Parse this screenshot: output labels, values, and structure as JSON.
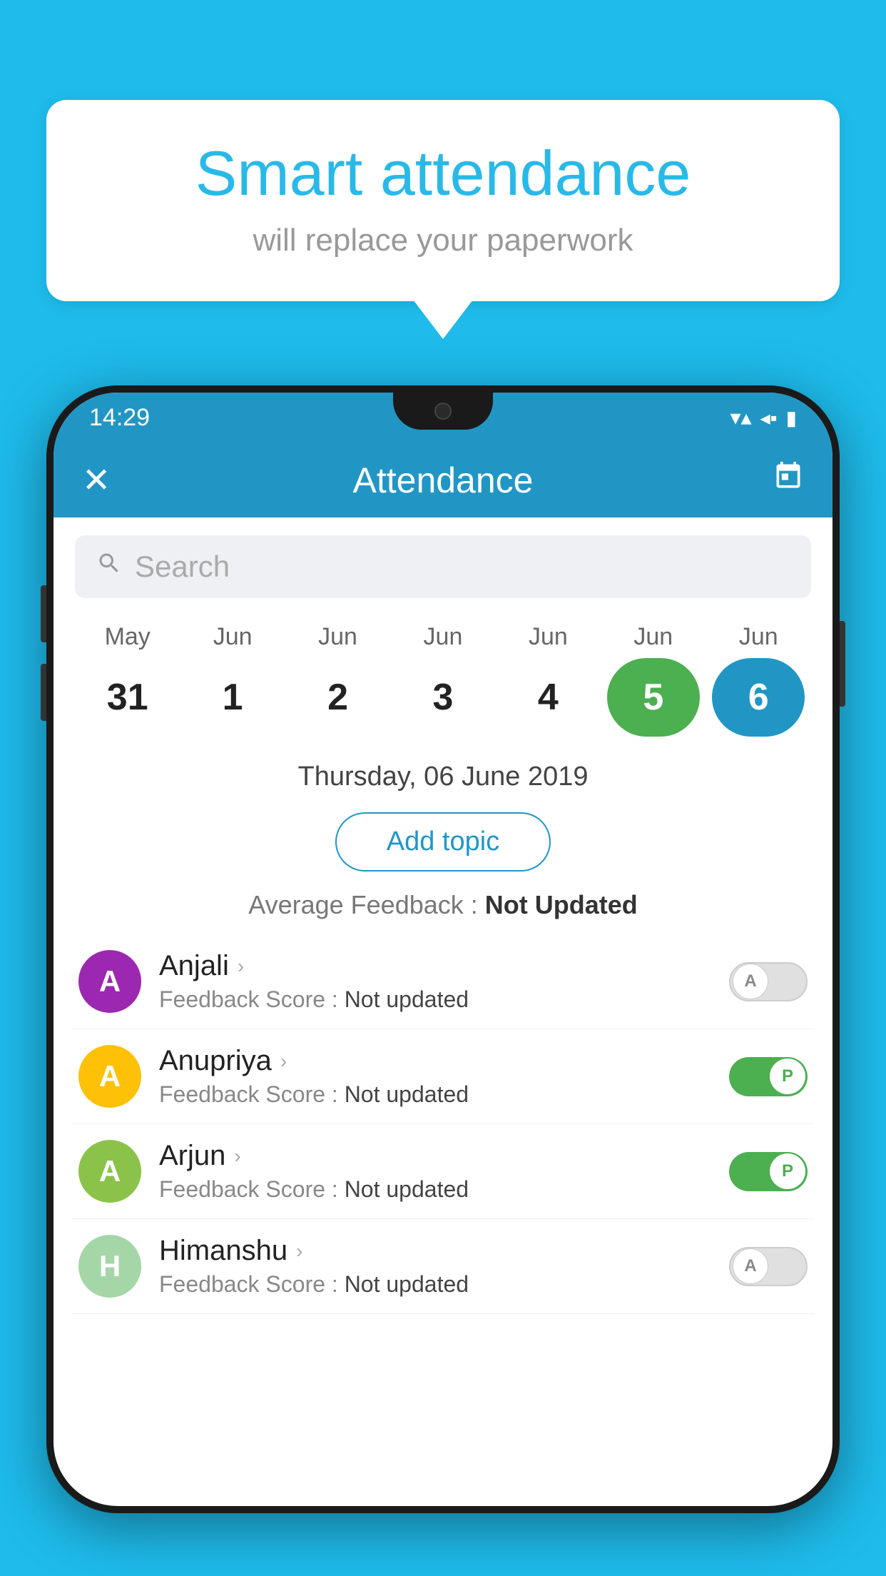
{
  "background_color": "#1EBBEB",
  "speech_bubble": {
    "title": "Smart attendance",
    "subtitle": "will replace your paperwork"
  },
  "status_bar": {
    "time": "14:29",
    "wifi_icon": "▾",
    "signal_icon": "◂",
    "battery_icon": "▮"
  },
  "app_bar": {
    "title": "Attendance",
    "close_label": "✕",
    "calendar_icon": "📅"
  },
  "search": {
    "placeholder": "Search"
  },
  "calendar": {
    "months": [
      "May",
      "Jun",
      "Jun",
      "Jun",
      "Jun",
      "Jun",
      "Jun"
    ],
    "dates": [
      "31",
      "1",
      "2",
      "3",
      "4",
      "5",
      "6"
    ],
    "today_index": 5,
    "selected_index": 6
  },
  "selected_date": "Thursday, 06 June 2019",
  "add_topic_label": "Add topic",
  "average_feedback": {
    "label": "Average Feedback : ",
    "value": "Not Updated"
  },
  "students": [
    {
      "name": "Anjali",
      "avatar_letter": "A",
      "avatar_color": "#9C27B0",
      "feedback_label": "Feedback Score : ",
      "feedback_value": "Not updated",
      "attendance": "A",
      "toggle_on": false
    },
    {
      "name": "Anupriya",
      "avatar_letter": "A",
      "avatar_color": "#FFC107",
      "feedback_label": "Feedback Score : ",
      "feedback_value": "Not updated",
      "attendance": "P",
      "toggle_on": true
    },
    {
      "name": "Arjun",
      "avatar_letter": "A",
      "avatar_color": "#8BC34A",
      "feedback_label": "Feedback Score : ",
      "feedback_value": "Not updated",
      "attendance": "P",
      "toggle_on": true
    },
    {
      "name": "Himanshu",
      "avatar_letter": "H",
      "avatar_color": "#A5D6A7",
      "feedback_label": "Feedback Score : ",
      "feedback_value": "Not updated",
      "attendance": "A",
      "toggle_on": false
    }
  ]
}
